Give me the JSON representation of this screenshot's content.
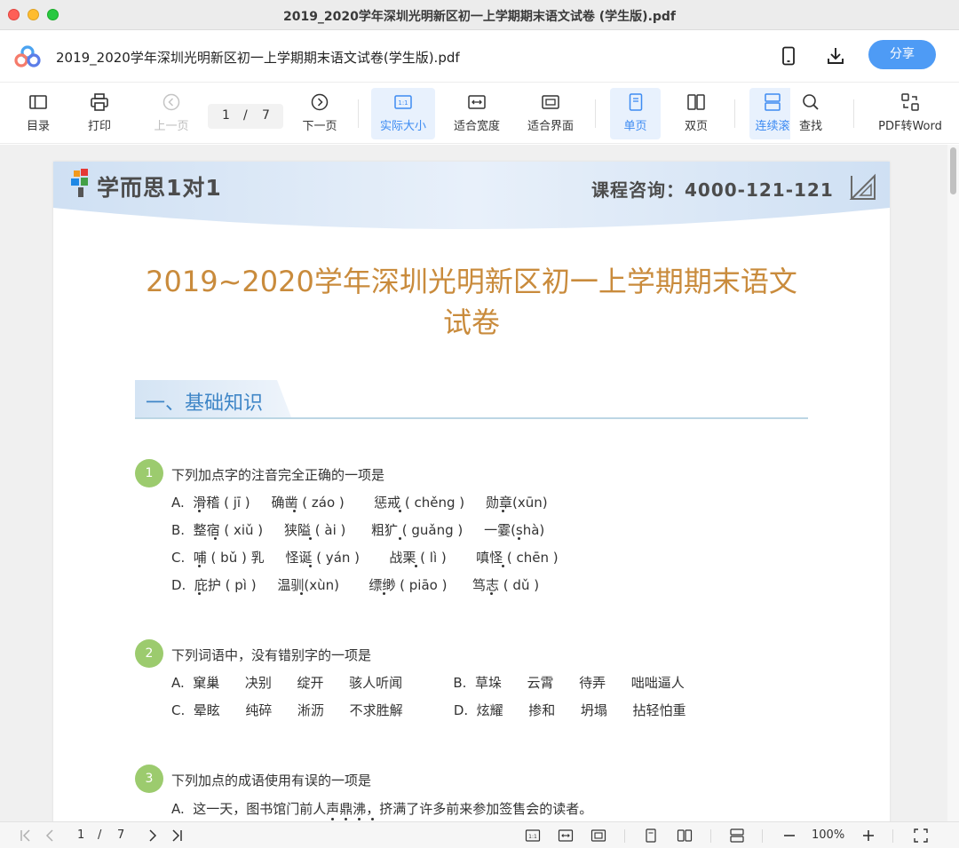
{
  "window": {
    "title": "2019_2020学年深圳光明新区初一上学期期末语文试卷 (学生版).pdf"
  },
  "header": {
    "file_name": "2019_2020学年深圳光明新区初一上学期期末语文试卷(学生版).pdf",
    "share_label": "分享",
    "icons": [
      "app-logo-icon",
      "phone-icon",
      "download-icon"
    ]
  },
  "toolbar": {
    "toc": "目录",
    "print": "打印",
    "prev": "上一页",
    "current_page": "1",
    "separator": "/",
    "total_pages": "7",
    "next": "下一页",
    "actual_size": "实际大小",
    "fit_width": "适合宽度",
    "fit_page": "适合界面",
    "single": "单页",
    "double": "双页",
    "continuous": "连续滚",
    "search": "查找",
    "pdf_to_word": "PDF转Word"
  },
  "document": {
    "brand": "学而思1对1",
    "hotline": "课程咨询：4000-121-121",
    "title_line1": "2019~2020学年深圳光明新区初一上学期期末语文",
    "title_line2": "试卷",
    "section_title": "一、基础知识",
    "questions": [
      {
        "number": "1",
        "text": "下列加点字的注音完全正确的一项是",
        "options": [
          "A.  滑稽 ( jī )     确凿 ( záo )       惩戒 ( chěng )     勋章(xūn)",
          "B.  整宿 ( xiǔ )     狭隘 ( ài )      粗犷 ( guǎng )     一霎(shà)",
          "C.  哺 ( bǔ ) 乳     怪诞 ( yán )       战栗 ( lì )       嗔怪 ( chēn )",
          "D.  庇护 ( pì )     温驯(xùn)       缥缈 ( piāo )      笃志 ( dǔ )"
        ]
      },
      {
        "number": "2",
        "text": "下列词语中，没有错别字的一项是",
        "options": [
          "A.  窠巢      决别      绽开      骇人听闻            B.  草垛      云霄      待弄      咄咄逼人",
          "C.  晕眩      纯碎      淅沥      不求胜解            D.  炫耀      掺和      坍塌      拈轻怕重"
        ]
      },
      {
        "number": "3",
        "text": "下列加点的成语使用有误的一项是",
        "options": [
          "A.  这一天，图书馆门前人声鼎沸，挤满了许多前来参加签售会的读者。"
        ]
      }
    ]
  },
  "statusbar": {
    "current_page": "1",
    "separator": "/",
    "total_pages": "7",
    "zoom": "100%"
  },
  "colors": {
    "accent": "#4e9bf5",
    "title": "#c98b3c",
    "section": "#3f86c7",
    "question_badge": "#9ccb6e"
  }
}
